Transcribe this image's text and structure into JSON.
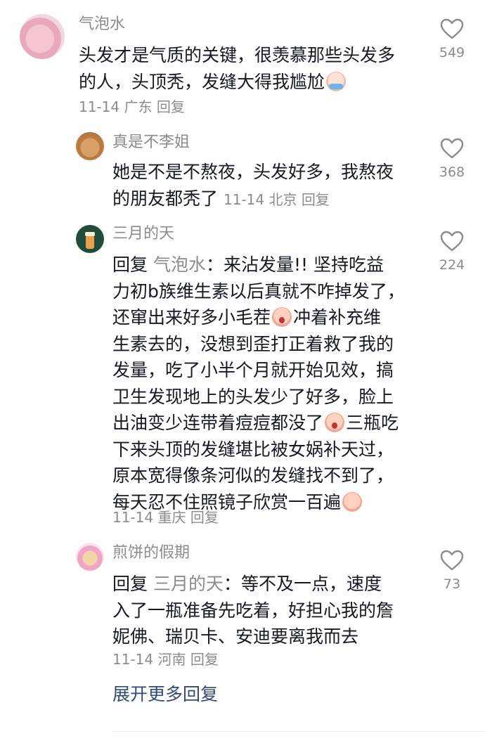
{
  "comments": [
    {
      "author": "气泡水",
      "lines": [
        "头发才是气质的关键，很羡慕那些头发多",
        "的人，头顶秃，发缝大得我尴尬"
      ],
      "emoji_after": "crying-emoji",
      "date": "11-14",
      "location": "广东",
      "reply_label": "回复",
      "likes": "549"
    },
    {
      "author": "真是不李姐",
      "lines": [
        "她是不是不熬夜，头发好多，我熬夜",
        "的朋友都秃了"
      ],
      "date": "11-14",
      "location": "北京",
      "reply_label": "回复",
      "likes": "368"
    },
    {
      "author": "三月的天",
      "reply_word": "回复",
      "reply_to": "气泡水",
      "reply_colon": "：",
      "segments": {
        "s1": "来沾发量!! 坚持吃益",
        "s2": "力初b族维生素以后真就不咋掉发了，",
        "s3": "还窜出来好多小毛茬",
        "s4": "冲着补充维",
        "s5": "生素去的，没想到歪打正着救了我的",
        "s6": "发量，吃了小半个月就开始见效，搞",
        "s7": "卫生发现地上的头发少了好多，脸上",
        "s8": "出油变少连带着痘痘都没了",
        "s9": "三瓶吃",
        "s10": "下来头顶的发缝堪比被女娲补天过，",
        "s11": "原本宽得像条河似的发缝找不到了，",
        "s12": "每天忍不住照镜子欣赏一百遍"
      },
      "date": "11-14",
      "location": "重庆",
      "reply_label": "回复",
      "likes": "224"
    },
    {
      "author": "煎饼的假期",
      "reply_word": "回复",
      "reply_to": "三月的天",
      "reply_colon": "：",
      "lines": [
        "等不及一点，速度",
        "入了一瓶准备先吃着，好担心我的詹",
        "妮佛、瑞贝卡、安迪要离我而去"
      ],
      "date": "11-14",
      "location": "河南",
      "reply_label": "回复",
      "likes": "73"
    }
  ],
  "expand_label": "展开更多回复",
  "colors": {
    "text": "#161823",
    "secondary": "#8a8b91",
    "link": "#2f4a7b"
  },
  "icons": {
    "like": "heart-outline-icon"
  }
}
